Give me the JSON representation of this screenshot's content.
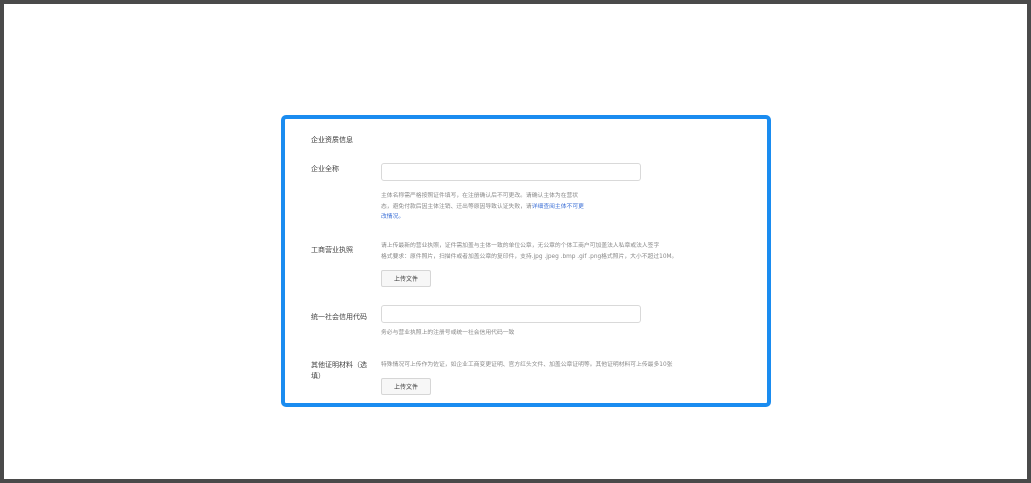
{
  "form": {
    "section_title": "企业资质信息",
    "company_name": {
      "label": "企业全称",
      "value": "",
      "hint_part1": "主体名称需严格按照证件填写，在注册确认后不可更改。请确认主体为在营状",
      "hint_part2": "态，避免付款后因主体注销、迁出等原因导致认证失败，请",
      "hint_link1": "详细查阅主体不可更",
      "hint_link2": "改情况。"
    },
    "business_license": {
      "label": "工商营业执照",
      "hint_line1": "请上传最新的营业执照，证件需加盖与主体一致的单位公章，无公章的个体工商户可加盖法人私章或法人签字",
      "hint_line2": "格式要求：原件照片，扫描件或者加盖公章的复印件，支持.jpg .jpeg .bmp .gif .png格式照片，大小不超过10M。",
      "upload_label": "上传文件"
    },
    "credit_code": {
      "label": "统一社会信用代码",
      "value": "",
      "hint": "务必与营业执照上的注册号或统一社会信用代码一致"
    },
    "other_materials": {
      "label_line1": "其他证明材料（选",
      "label_line2": "填）",
      "hint": "特殊情况可上传作为佐证，如企业工商变更证明、官方红头文件、加盖公章证明等。其他证明材料可上传最多10张",
      "upload_label": "上传文件"
    }
  },
  "colors": {
    "card_border": "#1a8cf0",
    "frame_border": "#4a4a4a",
    "link": "#3b6fd6"
  }
}
